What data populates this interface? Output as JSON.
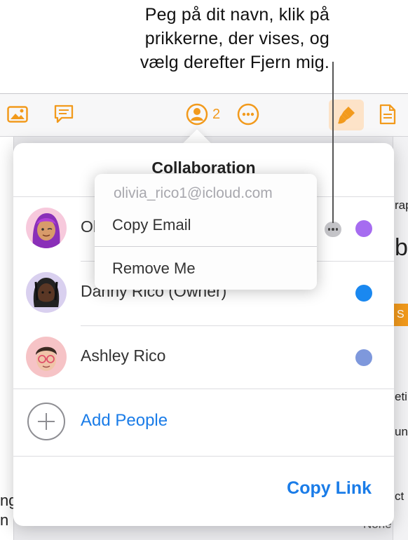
{
  "callout": {
    "line1": "Peg på dit navn, klik på",
    "line2": "prikkerne, der vises, og",
    "line3": "vælg derefter Fjern mig."
  },
  "toolbar": {
    "collaborator_count": "2",
    "icons": [
      "photo-icon",
      "comment-icon",
      "collaborators-icon",
      "more-icon",
      "format-brush-icon",
      "document-icon"
    ],
    "accent_color": "#f29a1c"
  },
  "popover": {
    "title": "Collaboration",
    "participants": [
      {
        "name": "Ol",
        "color": "#a66cf0",
        "avatar": "woman-purple-hair-memoji"
      },
      {
        "name": "Danny Rico (Owner)",
        "color": "#1a88f0",
        "avatar": "man-dreadlocks-memoji"
      },
      {
        "name": "Ashley Rico",
        "color": "#7e98dc",
        "avatar": "woman-glasses-memoji"
      }
    ],
    "add_people": "Add People",
    "copy_link": "Copy Link",
    "link_color": "#1a7ce8"
  },
  "context_menu": {
    "email": "olivia_rico1@icloud.com",
    "copy_email": "Copy Email",
    "remove_me": "Remove Me"
  },
  "background_fragments": {
    "right_1": "rap",
    "right_2": "b",
    "right_3": "S",
    "right_4": "eti",
    "right_5": "un",
    "right_6": "ct",
    "right_7": "None",
    "left_1": "ng",
    "left_2": "n"
  }
}
